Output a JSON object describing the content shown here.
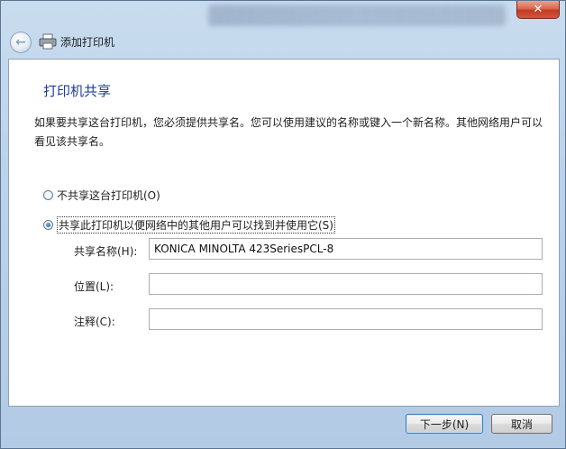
{
  "window": {
    "close_glyph": "✕",
    "title": "添加打印机",
    "back_glyph": "←"
  },
  "page": {
    "heading": "打印机共享",
    "description": "如果要共享这台打印机，您必须提供共享名。您可以使用建议的名称或键入一个新名称。其他网络用户可以看见该共享名。"
  },
  "options": {
    "no_share_label": "不共享这台打印机(O)",
    "no_share_checked": false,
    "share_label": "共享此打印机以便网络中的其他用户可以找到并使用它(S)",
    "share_checked": true
  },
  "fields": {
    "share_name_label": "共享名称(H):",
    "share_name_value": "KONICA MINOLTA 423SeriesPCL-8",
    "location_label": "位置(L):",
    "location_value": "",
    "comment_label": "注释(C):",
    "comment_value": ""
  },
  "buttons": {
    "next_label": "下一步(N)",
    "cancel_label": "取消"
  },
  "colors": {
    "heading": "#1a3e9a",
    "frame": "#bcd2ea",
    "close": "#c23b22"
  }
}
